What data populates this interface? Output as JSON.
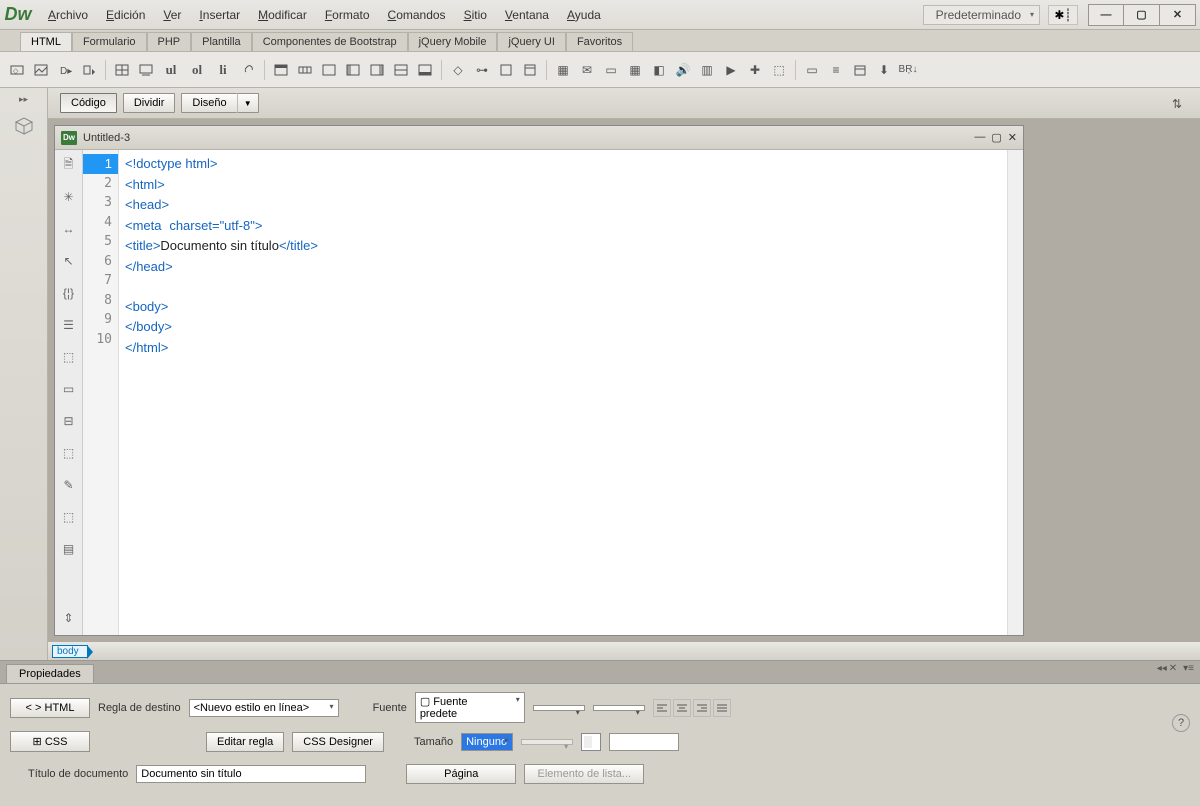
{
  "app": {
    "logo": "Dw"
  },
  "menu": [
    {
      "u": "A",
      "rest": "rchivo"
    },
    {
      "u": "E",
      "rest": "dición"
    },
    {
      "u": "V",
      "rest": "er"
    },
    {
      "u": "I",
      "rest": "nsertar"
    },
    {
      "u": "M",
      "rest": "odificar"
    },
    {
      "u": "F",
      "rest": "ormato"
    },
    {
      "u": "C",
      "rest": "omandos"
    },
    {
      "u": "S",
      "rest": "itio"
    },
    {
      "u": "V",
      "rest": "entana"
    },
    {
      "u": "A",
      "rest": "yuda"
    }
  ],
  "workspace": "Predeterminado",
  "tabs": [
    "HTML",
    "Formulario",
    "PHP",
    "Plantilla",
    "Componentes de Bootstrap",
    "jQuery Mobile",
    "jQuery UI",
    "Favoritos"
  ],
  "active_tab": 0,
  "iconbar_text": {
    "ul": "ul",
    "ol": "ol",
    "li": "li"
  },
  "doc": {
    "code_btn": "Código",
    "split_btn": "Dividir",
    "design_btn": "Diseño",
    "title": "Untitled-3",
    "tag_selector": "body",
    "code_lines": [
      {
        "n": 1,
        "html": "<span class='tag'>&lt;!doctype html&gt;</span>"
      },
      {
        "n": 2,
        "html": "<span class='tag'>&lt;html&gt;</span>"
      },
      {
        "n": 3,
        "html": "<span class='tag'>&lt;head&gt;</span>"
      },
      {
        "n": 4,
        "html": "<span class='tag'>&lt;meta</span> <span class='attr'>charset=</span><span class='str'>\"utf-8\"</span><span class='tag'>&gt;</span>"
      },
      {
        "n": 5,
        "html": "<span class='tag'>&lt;title&gt;</span><span class='txt'>Documento sin título</span><span class='tag'>&lt;/title&gt;</span>"
      },
      {
        "n": 6,
        "html": "<span class='tag'>&lt;/head&gt;</span>"
      },
      {
        "n": 7,
        "html": ""
      },
      {
        "n": 8,
        "html": "<span class='tag'>&lt;body&gt;</span>"
      },
      {
        "n": 9,
        "html": "<span class='tag'>&lt;/body&gt;</span>"
      },
      {
        "n": 10,
        "html": "<span class='tag'>&lt;/html&gt;</span>"
      }
    ]
  },
  "props": {
    "tab": "Propiedades",
    "html_btn": "HTML",
    "css_btn": "CSS",
    "rule_label": "Regla de destino",
    "rule_value": "<Nuevo estilo en línea>",
    "edit_rule": "Editar regla",
    "css_designer": "CSS Designer",
    "font_label": "Fuente",
    "font_value": "Fuente predete",
    "size_label": "Tamaño",
    "size_value": "Ninguno",
    "doc_title_label": "Título de documento",
    "doc_title_value": "Documento sin título",
    "page_btn": "Página",
    "list_btn": "Elemento de lista..."
  }
}
